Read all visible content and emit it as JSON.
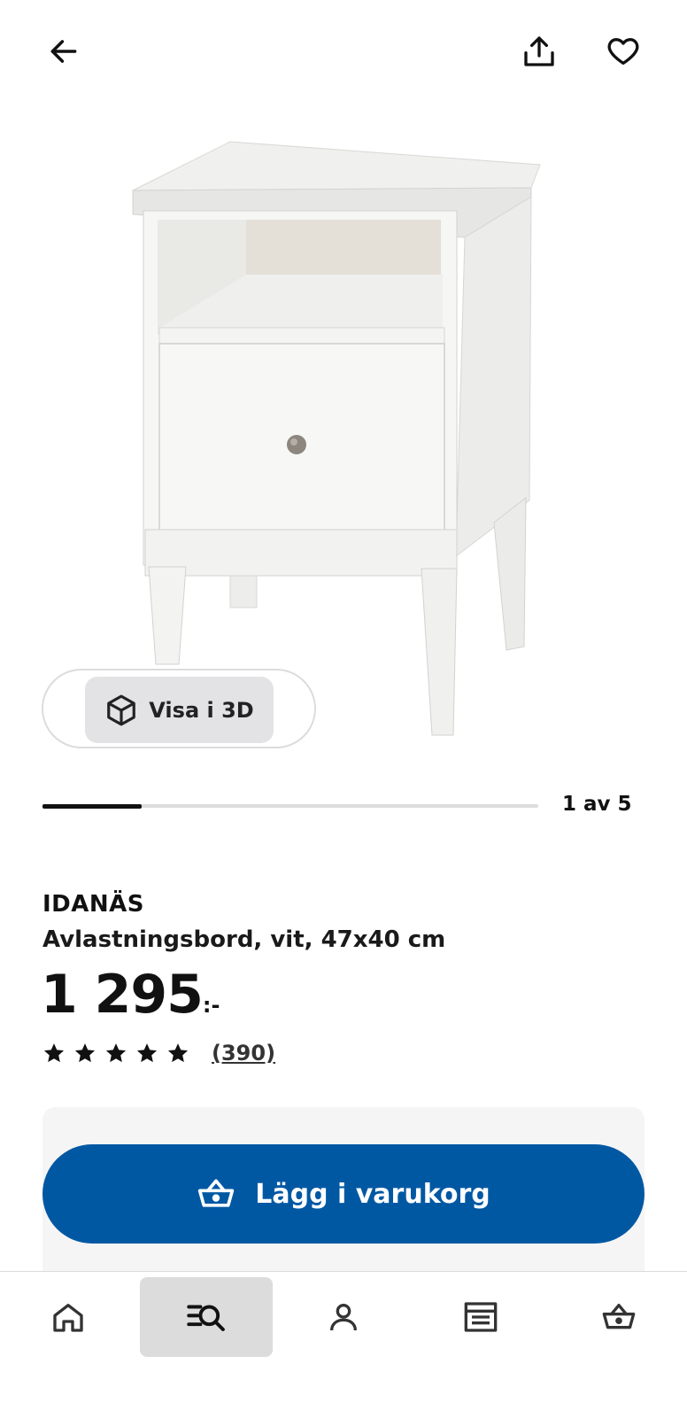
{
  "header": {
    "back_icon": "arrow-left-icon",
    "share_icon": "share-icon",
    "favorite_icon": "heart-icon"
  },
  "gallery": {
    "view_3d_label": "Visa i 3D",
    "position_label": "1 av 5",
    "progress_fraction": 0.2
  },
  "product": {
    "name": "IDANÄS",
    "description": "Avlastningsbord, vit, 47x40 cm",
    "price": "1 295",
    "price_suffix": ":-",
    "rating_stars": 5,
    "review_count": "(390)"
  },
  "cart": {
    "label": "Lägg i varukorg",
    "color": "#0058a3"
  },
  "nav": {
    "items": [
      {
        "name": "home",
        "icon": "home-icon"
      },
      {
        "name": "search",
        "icon": "search-list-icon",
        "active": true
      },
      {
        "name": "profile",
        "icon": "person-icon"
      },
      {
        "name": "store",
        "icon": "store-icon"
      },
      {
        "name": "basket",
        "icon": "basket-icon"
      }
    ]
  }
}
